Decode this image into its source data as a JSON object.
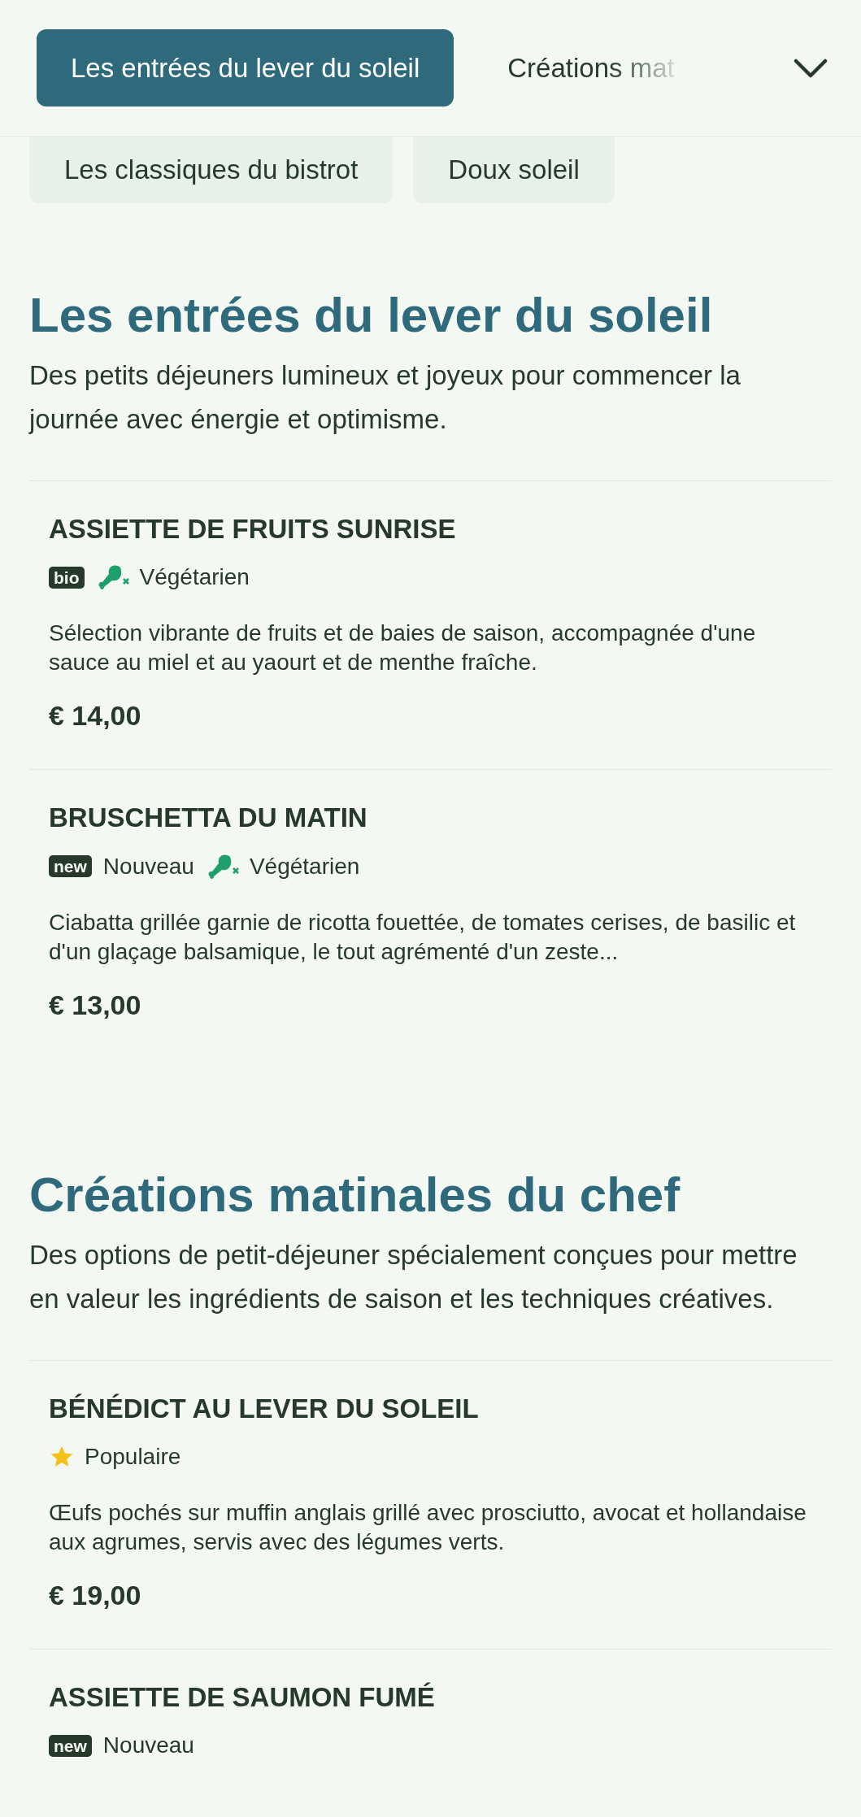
{
  "header": {
    "tabs": [
      {
        "label": "Les entrées du lever du soleil",
        "selected": true
      },
      {
        "label": "Créations mat",
        "selected": false
      }
    ]
  },
  "chips": [
    {
      "label": "Les classiques du bistrot",
      "selected": false
    },
    {
      "label": "Doux soleil",
      "selected": false
    }
  ],
  "sections": [
    {
      "title": "Les entrées du lever du soleil",
      "description": "Des petits déjeuners lumineux et joyeux pour commencer la journée avec énergie et optimisme.",
      "items": [
        {
          "name": "ASSIETTE DE FRUITS SUNRISE",
          "tags": [
            {
              "kind": "badge",
              "badge": "bio"
            },
            {
              "kind": "vegetarian",
              "label": "Végétarien"
            }
          ],
          "description": "Sélection vibrante de fruits et de baies de saison, accompagnée d'une sauce au miel et au yaourt et de menthe fraîche.",
          "price": "€ 14,00"
        },
        {
          "name": "BRUSCHETTA DU MATIN",
          "tags": [
            {
              "kind": "badge",
              "badge": "new",
              "label": "Nouveau"
            },
            {
              "kind": "vegetarian",
              "label": "Végétarien"
            }
          ],
          "description": "Ciabatta grillée garnie de ricotta fouettée, de tomates cerises, de basilic et d'un glaçage balsamique, le tout agrémenté d'un zeste...",
          "price": "€ 13,00"
        }
      ]
    },
    {
      "title": "Créations matinales du chef",
      "description": "Des options de petit-déjeuner spécialement conçues pour mettre en valeur les ingrédients de saison et les techniques créatives.",
      "items": [
        {
          "name": "BÉNÉDICT AU LEVER DU SOLEIL",
          "tags": [
            {
              "kind": "popular",
              "label": "Populaire"
            }
          ],
          "description": "Œufs pochés sur muffin anglais grillé avec prosciutto, avocat et hollandaise aux agrumes, servis avec des légumes verts.",
          "price": "€ 19,00"
        },
        {
          "name": "ASSIETTE DE SAUMON FUMÉ",
          "tags": [
            {
              "kind": "badge",
              "badge": "new",
              "label": "Nouveau"
            }
          ]
        }
      ]
    }
  ]
}
